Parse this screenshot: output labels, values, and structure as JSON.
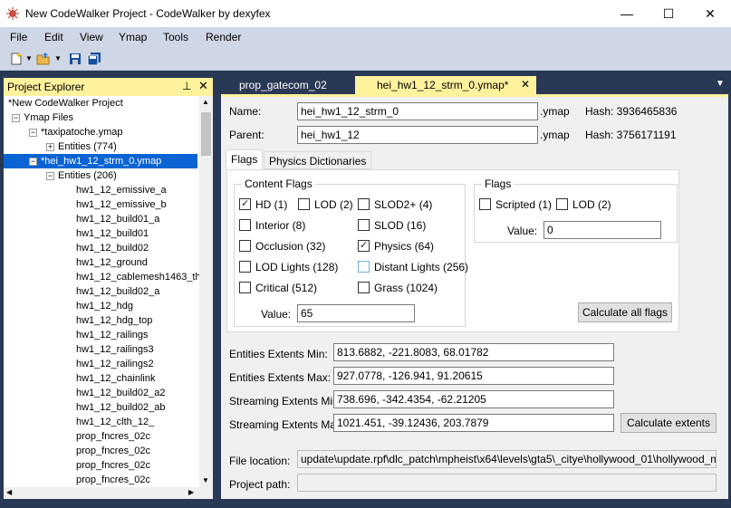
{
  "window": {
    "title": "New CodeWalker Project - CodeWalker by dexyfex",
    "minimize": "—",
    "maximize": "☐",
    "close": "✕"
  },
  "menu": [
    "File",
    "Edit",
    "View",
    "Ymap",
    "Tools",
    "Render"
  ],
  "explorer": {
    "title": "Project Explorer",
    "pin": "📌",
    "close": "✕",
    "tree": [
      {
        "label": "*New CodeWalker Project",
        "expander": ""
      },
      {
        "label": "Ymap Files",
        "expander": "−"
      },
      {
        "label": "*taxipatoche.ymap",
        "expander": "−"
      },
      {
        "label": "Entities (774)",
        "expander": "+"
      },
      {
        "label": "*hei_hw1_12_strm_0.ymap",
        "expander": "−"
      },
      {
        "label": "Entities (206)",
        "expander": "−"
      },
      {
        "label": "hw1_12_emissive_a",
        "expander": ""
      },
      {
        "label": "hw1_12_emissive_b",
        "expander": ""
      },
      {
        "label": "hw1_12_build01_a",
        "expander": ""
      },
      {
        "label": "hw1_12_build01",
        "expander": ""
      },
      {
        "label": "hw1_12_build02",
        "expander": ""
      },
      {
        "label": "hw1_12_ground",
        "expander": ""
      },
      {
        "label": "hw1_12_cablemesh1463_th",
        "expander": ""
      },
      {
        "label": "hw1_12_build02_a",
        "expander": ""
      },
      {
        "label": "hw1_12_hdg",
        "expander": ""
      },
      {
        "label": "hw1_12_hdg_top",
        "expander": ""
      },
      {
        "label": "hw1_12_railings",
        "expander": ""
      },
      {
        "label": "hw1_12_railings3",
        "expander": ""
      },
      {
        "label": "hw1_12_railings2",
        "expander": ""
      },
      {
        "label": "hw1_12_chainlink",
        "expander": ""
      },
      {
        "label": "hw1_12_build02_a2",
        "expander": ""
      },
      {
        "label": "hw1_12_build02_ab",
        "expander": ""
      },
      {
        "label": "hw1_12_clth_12_",
        "expander": ""
      },
      {
        "label": "prop_fncres_02c",
        "expander": ""
      },
      {
        "label": "prop_fncres_02c",
        "expander": ""
      },
      {
        "label": "prop_fncres_02c",
        "expander": ""
      },
      {
        "label": "prop_fncres_02c",
        "expander": ""
      }
    ]
  },
  "tabs": {
    "tab1": "prop_gatecom_02",
    "tab2": "hei_hw1_12_strm_0.ymap*",
    "tab2_close": "✕",
    "menu": "▼"
  },
  "ymap": {
    "name_label": "Name:",
    "name_value": "hei_hw1_12_strm_0",
    "name_ext": ".ymap",
    "name_hash": "Hash: 3936465836",
    "parent_label": "Parent:",
    "parent_value": "hei_hw1_12",
    "parent_ext": ".ymap",
    "parent_hash": "Hash: 3756171191",
    "tab_flags": "Flags",
    "tab_physics": "Physics Dictionaries",
    "content_flags_title": "Content Flags",
    "content_flags": [
      {
        "label": "HD (1)",
        "checked": true
      },
      {
        "label": "LOD (2)",
        "checked": false
      },
      {
        "label": "SLOD2+ (4)",
        "checked": false
      },
      {
        "label": "Interior (8)",
        "checked": false
      },
      {
        "label": "SLOD (16)",
        "checked": false
      },
      {
        "label": "Occlusion (32)",
        "checked": false
      },
      {
        "label": "Physics (64)",
        "checked": true
      },
      {
        "label": "LOD Lights (128)",
        "checked": false
      },
      {
        "label": "Distant Lights (256)",
        "checked": false
      },
      {
        "label": "Critical (512)",
        "checked": false
      },
      {
        "label": "Grass (1024)",
        "checked": false
      }
    ],
    "content_value_label": "Value:",
    "content_value": "65",
    "flags_title": "Flags",
    "flags": [
      {
        "label": "Scripted (1)",
        "checked": false
      },
      {
        "label": "LOD (2)",
        "checked": false
      }
    ],
    "flags_value_label": "Value:",
    "flags_value": "0",
    "calc_flags_button": "Calculate all flags",
    "ent_min_label": "Entities Extents Min:",
    "ent_min": "813.6882, -221.8083, 68.01782",
    "ent_max_label": "Entities Extents Max:",
    "ent_max": "927.0778, -126.941, 91.20615",
    "str_min_label": "Streaming Extents Min:",
    "str_min": "738.696, -342.4354, -62.21205",
    "str_max_label": "Streaming Extents Max:",
    "str_max": "1021.451, -39.12436, 203.7879",
    "calc_extents_button": "Calculate extents",
    "file_location_label": "File location:",
    "file_location": "update\\update.rpf\\dlc_patch\\mpheist\\x64\\levels\\gta5\\_citye\\hollywood_01\\hollywood_metadat",
    "project_path_label": "Project path:",
    "project_path": ""
  }
}
